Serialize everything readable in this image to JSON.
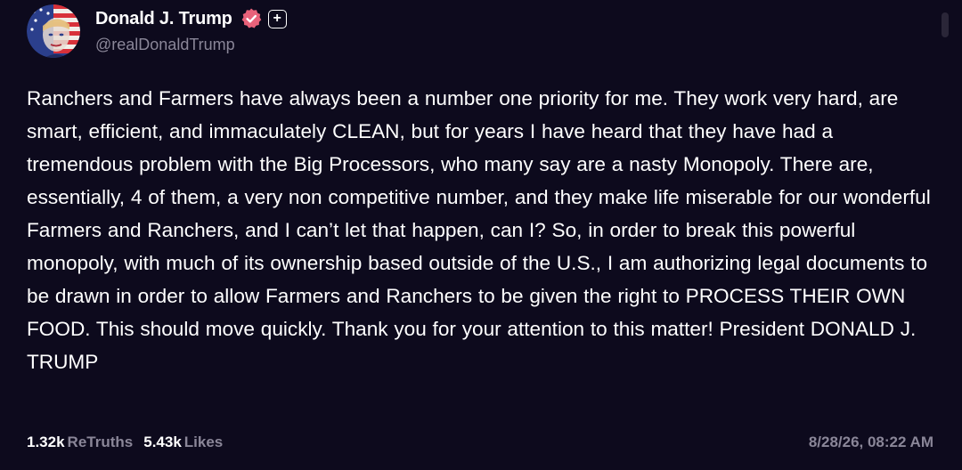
{
  "post": {
    "author": {
      "display_name": "Donald J. Trump",
      "handle": "@realDonaldTrump",
      "verified_icon": "verified-badge-icon",
      "avatar_icon": "flag-portrait-avatar"
    },
    "follow_button_label": "+",
    "body": "Ranchers and Farmers have always been a number one priority for me. They work very hard, are smart, efficient, and immaculately CLEAN, but for years I have heard that they have had a tremendous problem with the Big Processors, who many say are a nasty Monopoly. There are, essentially, 4 of them, a very non competitive number, and they make life miserable for our wonderful Farmers and Ranchers, and I can’t let that happen, can I? So, in order to break this powerful monopoly, with much of its ownership based outside of the U.S., I am authorizing legal documents to be drawn in order to allow Farmers and Ranchers to be given the right to PROCESS THEIR OWN FOOD. This should move quickly. Thank you for your attention to this matter! President DONALD J. TRUMP",
    "stats": {
      "retruths_count": "1.32k",
      "retruths_label": "ReTruths",
      "likes_count": "5.43k",
      "likes_label": "Likes"
    },
    "timestamp": "8/28/26, 08:22 AM"
  },
  "colors": {
    "background": "#0d0a1d",
    "text": "#ffffff",
    "muted": "#8a8698",
    "verified": "#e8627a"
  }
}
